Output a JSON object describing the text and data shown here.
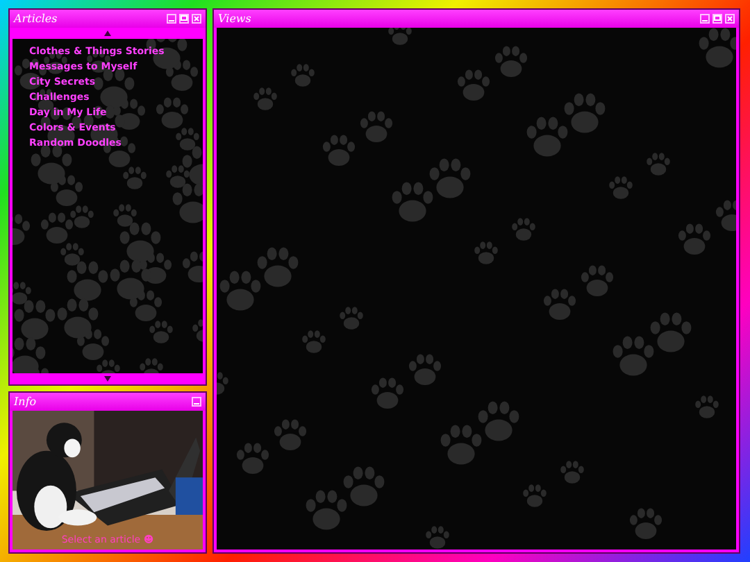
{
  "articles": {
    "title": "Articles",
    "items": [
      {
        "label": "Clothes & Things Stories"
      },
      {
        "label": "Messages to Myself"
      },
      {
        "label": "City Secrets"
      },
      {
        "label": "Challenges"
      },
      {
        "label": "Day in My Life"
      },
      {
        "label": "Colors & Events"
      },
      {
        "label": "Random Doodles"
      }
    ]
  },
  "info": {
    "title": "Info",
    "caption": "Select an article ☻"
  },
  "views": {
    "title": "Views"
  }
}
